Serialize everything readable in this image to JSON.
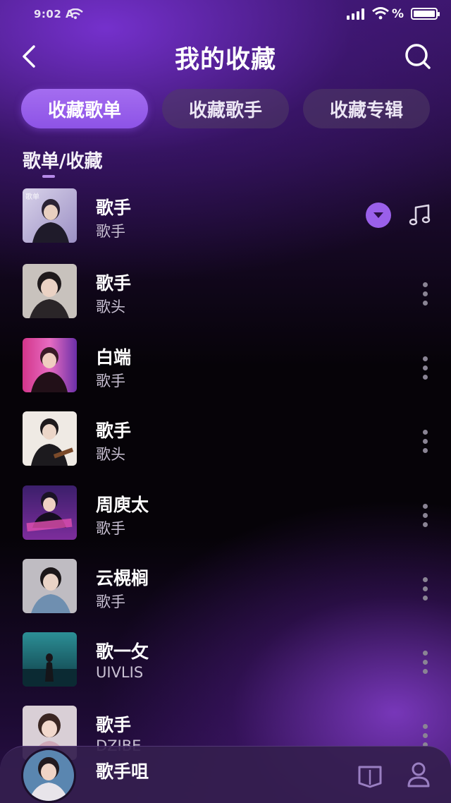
{
  "status_bar": {
    "left_text": "9:02 A",
    "battery_label": "%"
  },
  "header": {
    "title": "我的收藏"
  },
  "tabs": [
    {
      "label": "收藏歌单",
      "active": true
    },
    {
      "label": "收藏歌手",
      "active": false
    },
    {
      "label": "收藏专辑",
      "active": false
    }
  ],
  "section": {
    "label": "歌单/收藏"
  },
  "list": [
    {
      "title": "歌手",
      "subtitle": "歌手",
      "cover_tag": "歌单",
      "trailing": [
        "download-icon",
        "music-note-icon"
      ]
    },
    {
      "title": "歌手",
      "subtitle": "歌头",
      "cover_tag": "",
      "trailing": [
        "more-icon"
      ]
    },
    {
      "title": "白端",
      "subtitle": "歌手",
      "cover_tag": "",
      "trailing": [
        "more-icon"
      ]
    },
    {
      "title": "歌手",
      "subtitle": "歌头",
      "cover_tag": "",
      "trailing": [
        "more-icon"
      ]
    },
    {
      "title": "周庾太",
      "subtitle": "歌手",
      "cover_tag": "",
      "trailing": [
        "more-icon"
      ]
    },
    {
      "title": "云榥榈",
      "subtitle": "歌手",
      "cover_tag": "",
      "trailing": [
        "more-icon"
      ]
    },
    {
      "title": "歌一攵",
      "subtitle": "UIVLIS",
      "cover_tag": "",
      "trailing": [
        "more-icon"
      ]
    },
    {
      "title": "歌手",
      "subtitle": "DZIBE",
      "cover_tag": "",
      "trailing": [
        "more-icon"
      ]
    }
  ],
  "player": {
    "title": "歌手咀"
  },
  "colors": {
    "accent": "#9a60ea",
    "tab_active": "#a46df0",
    "background": "#070309"
  },
  "icons": [
    "back-icon",
    "search-icon",
    "download-icon",
    "music-note-icon",
    "more-icon",
    "playlist-icon",
    "profile-icon"
  ]
}
